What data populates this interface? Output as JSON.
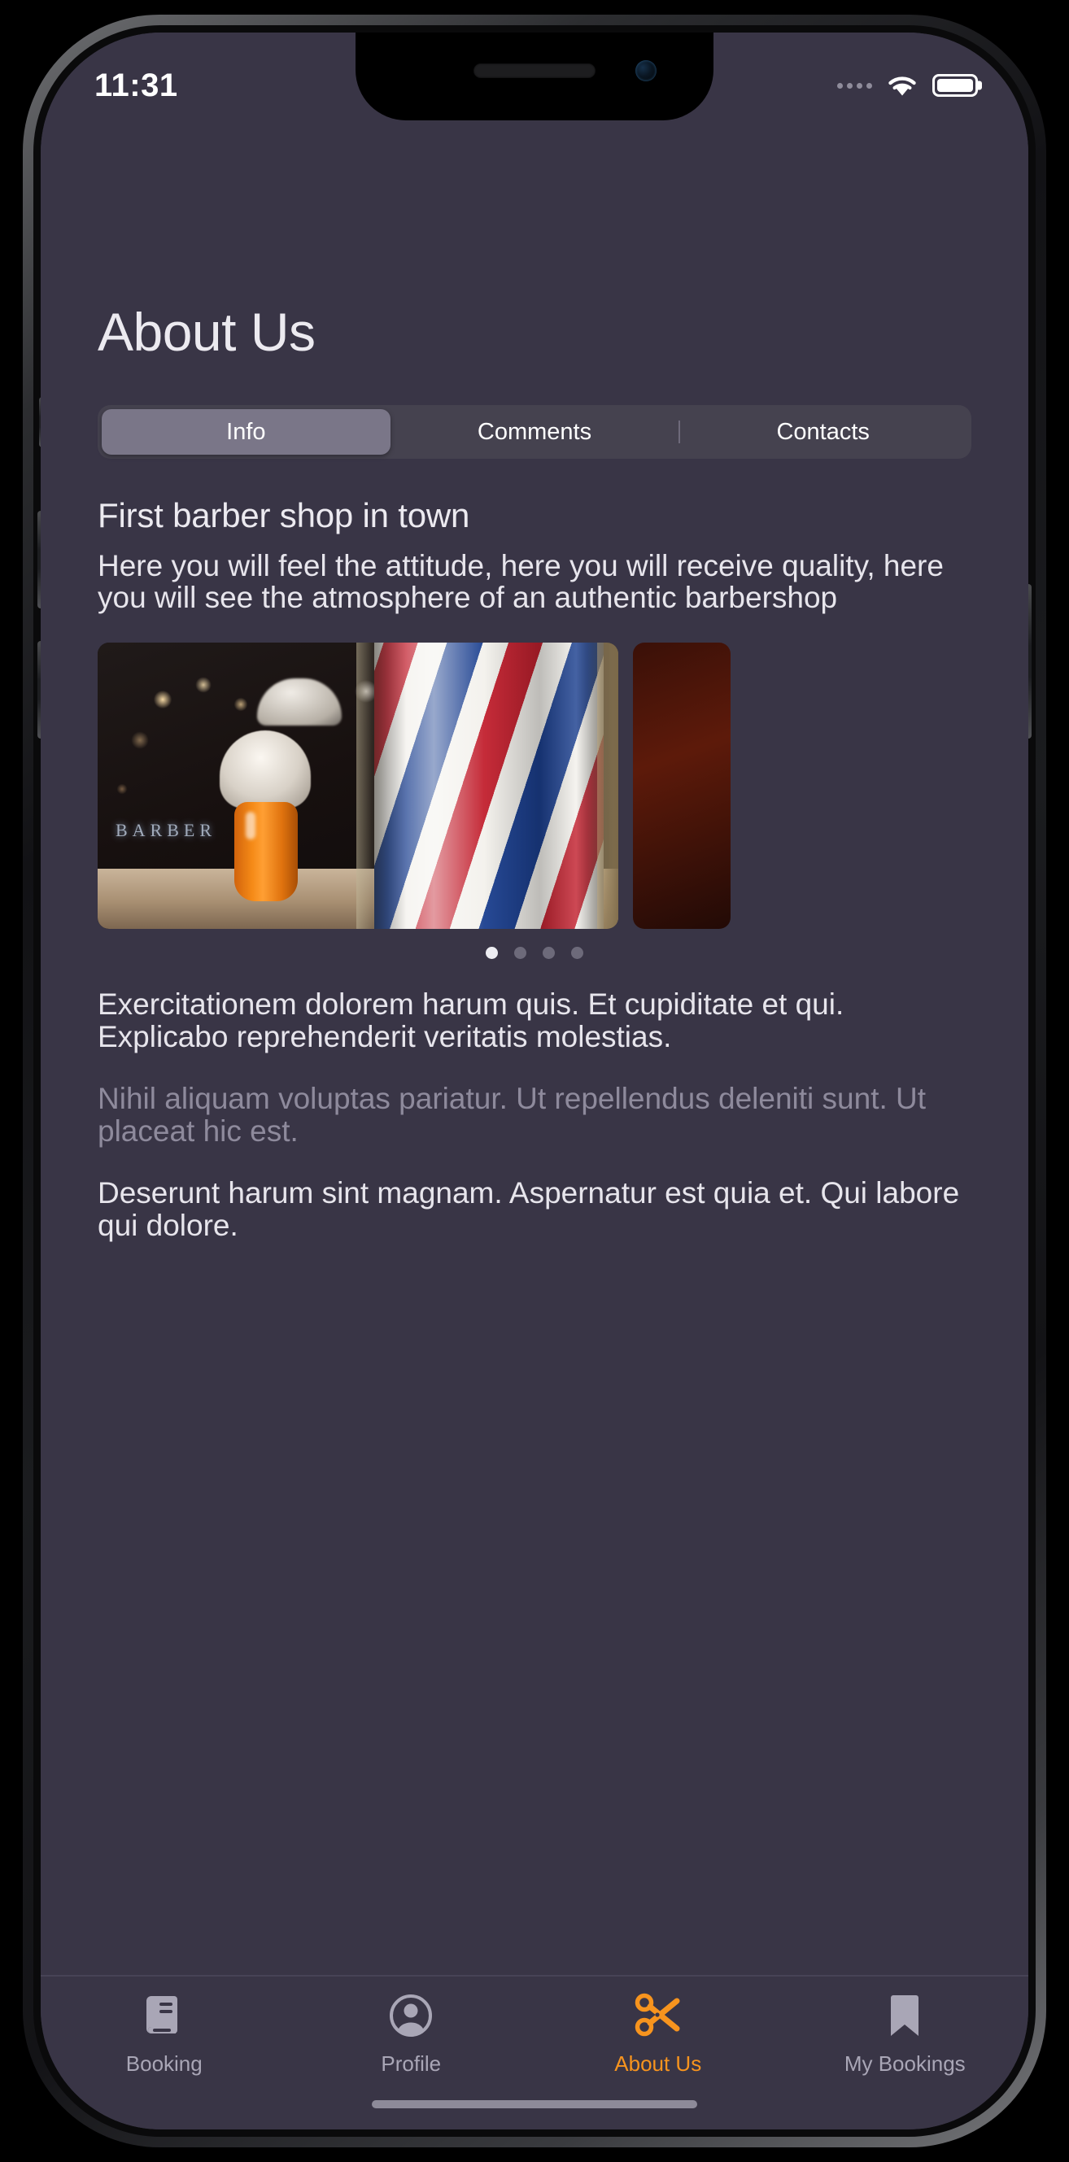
{
  "status_bar": {
    "time": "11:31",
    "signal_icon": "cellular-dots-icon",
    "wifi_icon": "wifi-icon",
    "battery_icon": "battery-full-icon",
    "battery_level_percent": 95
  },
  "page": {
    "title": "About Us"
  },
  "segmented_control": {
    "items": [
      {
        "label": "Info",
        "selected": true
      },
      {
        "label": "Comments",
        "selected": false
      },
      {
        "label": "Contacts",
        "selected": false
      }
    ]
  },
  "main": {
    "section_title": "First barber shop in town",
    "section_subtitle": "Here you will feel the attitude, here you will receive quality, here you will see the atmosphere of an authentic barbershop",
    "paragraphs": [
      {
        "text": "Exercitationem dolorem harum quis. Et cupiditate et qui. Explicabo reprehenderit veritatis molestias.",
        "muted": false
      },
      {
        "text": "Nihil aliquam voluptas pariatur. Ut repellendus deleniti sunt. Ut placeat hic est.",
        "muted": true
      },
      {
        "text": "Deserunt harum sint magnam. Aspernatur est quia et. Qui labore qui dolore.",
        "muted": false
      }
    ]
  },
  "carousel": {
    "slide_alt": "barbershop-shaving-brush-and-barber-pole-photo",
    "peek_slide_alt": "next-photo-peek",
    "page_count": 4,
    "active_page": 1
  },
  "tab_bar": {
    "items": [
      {
        "label": "Booking",
        "icon": "book-icon",
        "active": false
      },
      {
        "label": "Profile",
        "icon": "person-circle-icon",
        "active": false
      },
      {
        "label": "About Us",
        "icon": "scissors-icon",
        "active": true
      },
      {
        "label": "My Bookings",
        "icon": "bookmark-icon",
        "active": false
      }
    ]
  },
  "colors": {
    "background": "#393546",
    "accent": "#f7941e",
    "text_primary": "#e7e5ec",
    "text_muted": "#8e8a9c",
    "segment_track": "#45424f",
    "segment_active": "#7a7688"
  }
}
